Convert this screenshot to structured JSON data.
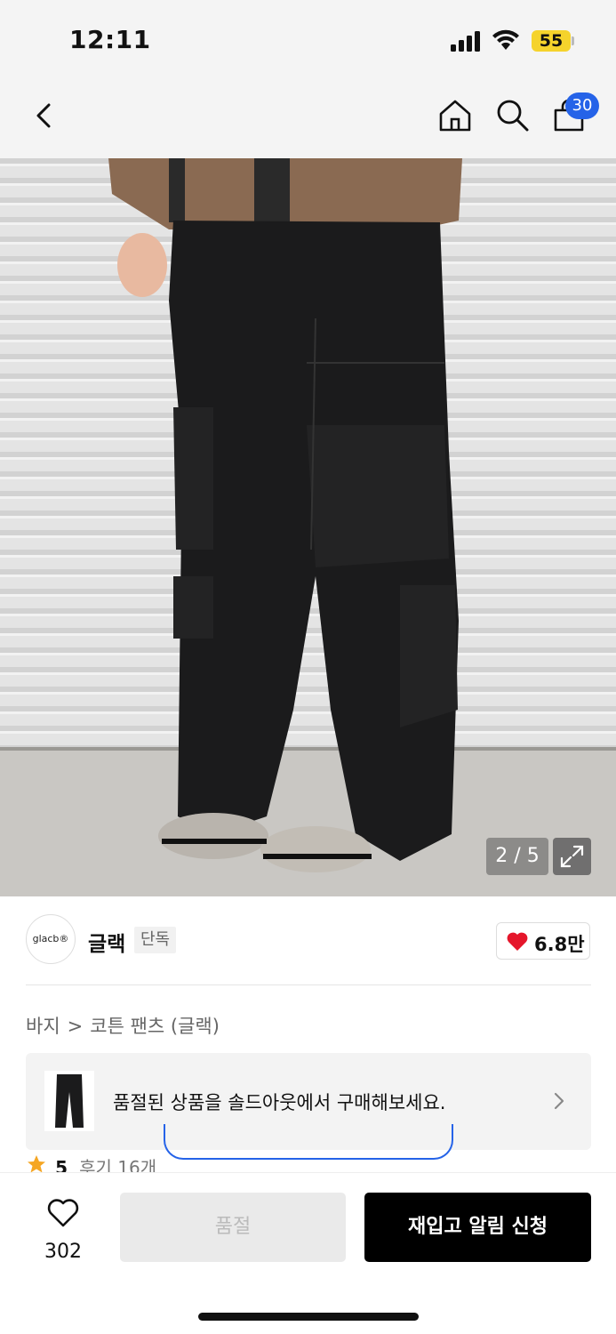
{
  "status_bar": {
    "time": "12:11",
    "battery": "55"
  },
  "header": {
    "back_icon": "chevron-left-icon",
    "home_icon": "home-icon",
    "search_icon": "search-icon",
    "bag_icon": "shopping-bag-icon",
    "bag_count": "30"
  },
  "gallery": {
    "counter": "2 / 5",
    "expand_icon": "expand-icon"
  },
  "brand": {
    "logo_text": "glacb®",
    "name": "글랙",
    "tag": "단독",
    "likes": "6.8만"
  },
  "breadcrumb": {
    "category": "바지",
    "separator": ">",
    "product": "코튼 팬츠 (글랙)"
  },
  "soldout_banner": {
    "text": "품절된 상품을 솔드아웃에서 구매해보세요."
  },
  "review": {
    "score": "5",
    "label": "후기 16개"
  },
  "bottom_bar": {
    "wish_count": "302",
    "soldout_label": "품절",
    "restock_label": "재입고 알림 신청"
  },
  "colors": {
    "accent_blue": "#2563e8",
    "heart_red": "#e5162b",
    "battery_yellow": "#f5d32c"
  }
}
